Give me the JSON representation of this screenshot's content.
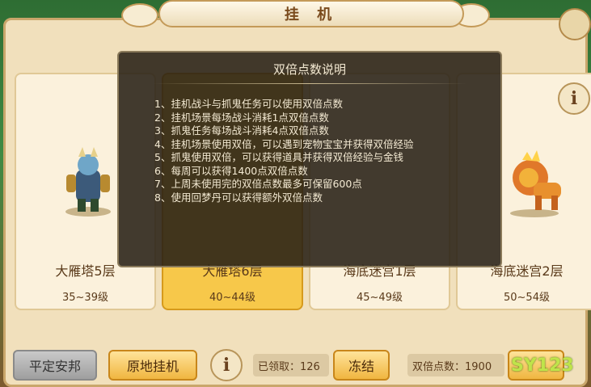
{
  "window": {
    "title": "挂 机"
  },
  "cards": [
    {
      "name": "大雁塔5层",
      "level": "35~39级",
      "selected": false
    },
    {
      "name": "大雁塔6层",
      "level": "40~44级",
      "selected": true
    },
    {
      "name": "海底迷宫1层",
      "level": "45~49级",
      "selected": false
    },
    {
      "name": "海底迷宫2层",
      "level": "50~54级",
      "selected": false
    }
  ],
  "dialog": {
    "title": "双倍点数说明",
    "items": [
      "1、挂机战斗与抓鬼任务可以使用双倍点数",
      "2、挂机场景每场战斗消耗1点双倍点数",
      "3、抓鬼任务每场战斗消耗4点双倍点数",
      "4、挂机场景使用双倍，可以遇到宠物宝宝并获得双倍经验",
      "5、抓鬼使用双倍，可以获得道具并获得双倍经验与金钱",
      "6、每周可以获得1400点双倍点数",
      "7、上周未使用完的双倍点数最多可保留600点",
      "8、使用回梦丹可以获得额外双倍点数"
    ]
  },
  "bottom": {
    "pacify_label": "平定安邦",
    "idle_label": "原地挂机",
    "claimed_label": "已领取：126",
    "freeze_label": "冻结",
    "double_points_label": "双倍点数：1900"
  },
  "watermark": "SY123",
  "info_glyph": "i"
}
